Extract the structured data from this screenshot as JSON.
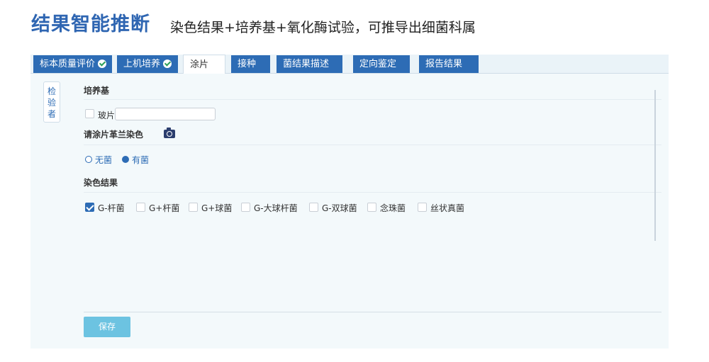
{
  "header": {
    "title": "结果智能推断",
    "subtitle": "染色结果+培养基+氧化酶试验，可推导出细菌科属"
  },
  "tabs": [
    {
      "label": "标本质量评价",
      "done": true
    },
    {
      "label": "上机培养",
      "done": true
    },
    {
      "label": "涂片",
      "active": true
    },
    {
      "label": "接种"
    },
    {
      "label": "菌结果描述"
    },
    {
      "label": "定向鉴定"
    },
    {
      "label": "报告结果"
    }
  ],
  "side": {
    "chars": [
      "检",
      "验",
      "者"
    ]
  },
  "culture": {
    "title": "培养基",
    "slide_checkbox": {
      "label": "玻片",
      "checked": false
    },
    "slide_input": {
      "value": "",
      "placeholder": ""
    }
  },
  "gram": {
    "title": "请涂片革兰染色",
    "camera_icon": "camera-icon",
    "options": [
      {
        "label": "无菌",
        "selected": false
      },
      {
        "label": "有菌",
        "selected": true
      }
    ]
  },
  "stain_result": {
    "title": "染色结果",
    "options": [
      {
        "label": "G-杆菌",
        "checked": true
      },
      {
        "label": "G+杆菌",
        "checked": false
      },
      {
        "label": "G+球菌",
        "checked": false
      },
      {
        "label": "G-大球杆菌",
        "checked": false
      },
      {
        "label": "G-双球菌",
        "checked": false
      },
      {
        "label": "念珠菌",
        "checked": false
      },
      {
        "label": "丝状真菌",
        "checked": false
      }
    ]
  },
  "actions": {
    "save_label": "保存"
  },
  "colors": {
    "accent": "#2d6cb5",
    "title": "#2f66b2",
    "save_button": "#6cc3e1"
  }
}
